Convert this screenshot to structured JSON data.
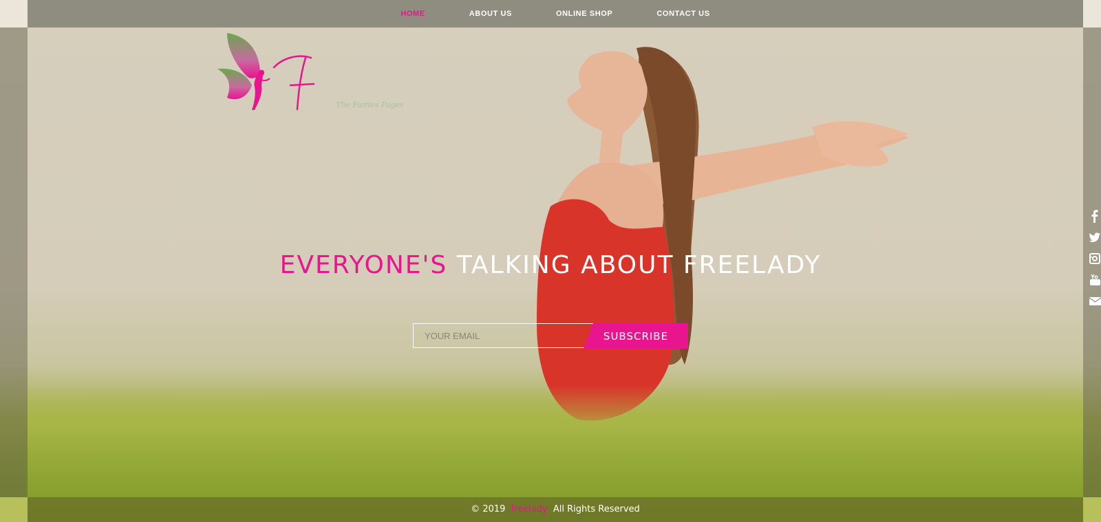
{
  "nav": {
    "items": [
      {
        "label": "HOME",
        "active": true
      },
      {
        "label": "ABOUT US",
        "active": false
      },
      {
        "label": "ONLINE SHOP",
        "active": false
      },
      {
        "label": "CONTACT US",
        "active": false
      }
    ]
  },
  "logo": {
    "letter": "F",
    "tagline": "The Fairies Pages",
    "icon": "fairy-butterfly-icon"
  },
  "hero": {
    "headline_part1": "EVERYONE'S",
    "headline_part2": "TALKING ABOUT FREELADY"
  },
  "subscribe": {
    "placeholder": "YOUR EMAIL",
    "button_label": "SUBSCRIBE"
  },
  "social": [
    {
      "name": "facebook-icon"
    },
    {
      "name": "twitter-icon"
    },
    {
      "name": "instagram-icon"
    },
    {
      "name": "youtube-icon"
    },
    {
      "name": "email-icon"
    }
  ],
  "footer": {
    "copyright": "© 2019",
    "brand": "freelady",
    "rights": "All Rights Reserved"
  },
  "colors": {
    "accent": "#e8158f",
    "nav_bg": "#8f8d80"
  }
}
